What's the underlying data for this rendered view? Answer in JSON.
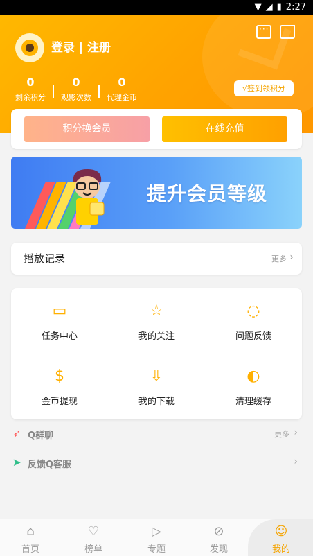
{
  "status_bar": {
    "time": "2:27"
  },
  "header": {
    "login_text": "登录 | 注册",
    "stats": [
      {
        "value": "0",
        "label": "剩余积分"
      },
      {
        "value": "0",
        "label": "观影次数"
      },
      {
        "value": "0",
        "label": "代理金币"
      }
    ],
    "signin_label": "√签到领积分"
  },
  "actions": {
    "points_label": "积分换会员",
    "recharge_label": "在线充值"
  },
  "banner": {
    "title": "提升会员等级"
  },
  "history": {
    "title": "播放记录",
    "more": "更多"
  },
  "grid": [
    {
      "label": "任务中心",
      "icon": "task-card-icon"
    },
    {
      "label": "我的关注",
      "icon": "star-icon"
    },
    {
      "label": "问题反馈",
      "icon": "feedback-bubble-icon"
    },
    {
      "label": "金币提现",
      "icon": "coin-dollar-icon"
    },
    {
      "label": "我的下载",
      "icon": "download-icon"
    },
    {
      "label": "清理缓存",
      "icon": "clean-icon"
    }
  ],
  "rows": [
    {
      "label": "Q群聊",
      "more": "更多",
      "icon": "rocket-icon"
    },
    {
      "label": "反馈Q客服",
      "more": "",
      "icon": "paper-plane-icon"
    }
  ],
  "tabs": [
    {
      "label": "首页",
      "icon": "home-icon"
    },
    {
      "label": "榜单",
      "icon": "heart-icon"
    },
    {
      "label": "专题",
      "icon": "play-box-icon"
    },
    {
      "label": "发现",
      "icon": "compass-icon"
    },
    {
      "label": "我的",
      "icon": "user-icon"
    }
  ],
  "colors": {
    "accent": "#f5a400",
    "banner": "#3f7cf2"
  }
}
